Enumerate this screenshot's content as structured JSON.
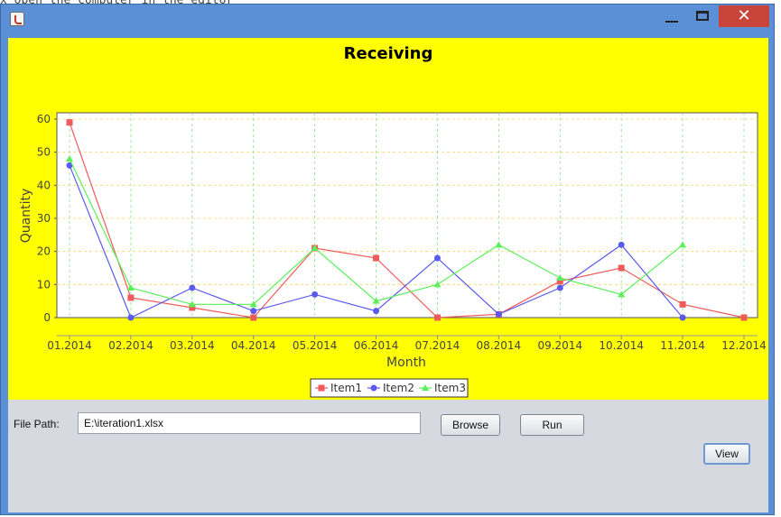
{
  "background": {
    "text": "x open the computer in the editor"
  },
  "window": {
    "title": "",
    "controls": {
      "minimize": "minimize",
      "maximize": "maximize",
      "close": "✕"
    }
  },
  "chart_data": {
    "type": "line",
    "title": "Receiving",
    "xlabel": "Month",
    "ylabel": "Quantity",
    "categories": [
      "01.2014",
      "02.2014",
      "03.2014",
      "04.2014",
      "05.2014",
      "06.2014",
      "07.2014",
      "08.2014",
      "09.2014",
      "10.2014",
      "11.2014",
      "12.2014"
    ],
    "yticks": [
      0,
      10,
      20,
      30,
      40,
      50,
      60
    ],
    "ylim": [
      0,
      62
    ],
    "grid": true,
    "legend_position": "bottom",
    "series": [
      {
        "name": "Item1",
        "color": "#f05a5a",
        "marker": "square",
        "x": [
          "01.2014",
          "02.2014",
          "03.2014",
          "04.2014",
          "05.2014",
          "06.2014",
          "07.2014",
          "08.2014",
          "09.2014",
          "10.2014",
          "11.2014",
          "12.2014"
        ],
        "values": [
          59,
          6,
          3,
          0,
          21,
          18,
          0,
          1,
          11,
          15,
          4,
          0
        ]
      },
      {
        "name": "Item2",
        "color": "#5a5af0",
        "marker": "circle",
        "x": [
          "01.2014",
          "02.2014",
          "03.2014",
          "04.2014",
          "05.2014",
          "06.2014",
          "07.2014",
          "08.2014",
          "09.2014",
          "10.2014",
          "11.2014"
        ],
        "values": [
          46,
          0,
          9,
          2,
          7,
          2,
          18,
          1,
          9,
          22,
          0
        ]
      },
      {
        "name": "Item3",
        "color": "#5af05a",
        "marker": "triangle",
        "x": [
          "01.2014",
          "02.2014",
          "03.2014",
          "04.2014",
          "05.2014",
          "06.2014",
          "07.2014",
          "08.2014",
          "09.2014",
          "10.2014",
          "11.2014"
        ],
        "values": [
          48,
          9,
          4,
          4,
          21,
          5,
          10,
          22,
          12,
          7,
          22
        ]
      }
    ]
  },
  "form": {
    "file_path_label": "File Path:",
    "file_path_value": "E:\\iteration1.xlsx",
    "browse_label": "Browse",
    "run_label": "Run",
    "view_label": "View"
  }
}
